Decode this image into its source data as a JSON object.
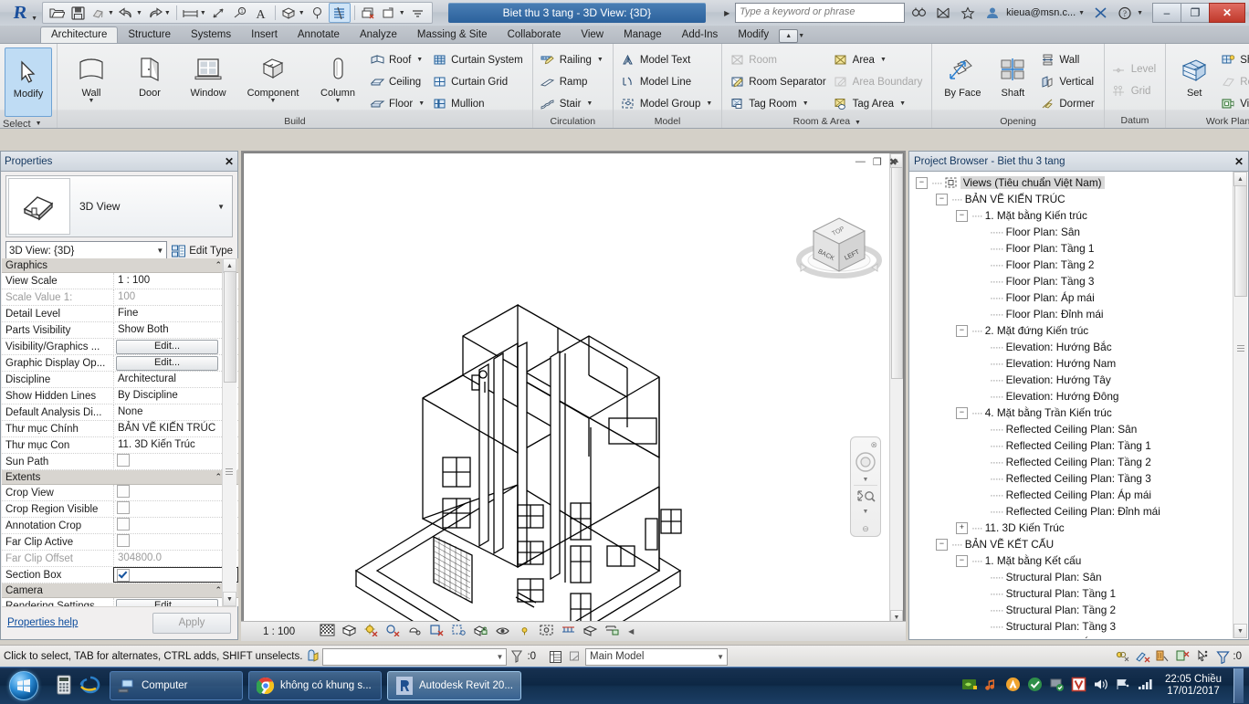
{
  "titlebar": {
    "app_title": "Biet thu 3 tang - 3D View: {3D}",
    "search_placeholder": "Type a keyword or phrase",
    "user": "kieua@msn.c...",
    "minimize": "–",
    "restore": "❐",
    "close": "✕"
  },
  "tabs": [
    {
      "label": "Architecture",
      "active": true
    },
    {
      "label": "Structure",
      "active": false
    },
    {
      "label": "Systems",
      "active": false
    },
    {
      "label": "Insert",
      "active": false
    },
    {
      "label": "Annotate",
      "active": false
    },
    {
      "label": "Analyze",
      "active": false
    },
    {
      "label": "Massing & Site",
      "active": false
    },
    {
      "label": "Collaborate",
      "active": false
    },
    {
      "label": "View",
      "active": false
    },
    {
      "label": "Manage",
      "active": false
    },
    {
      "label": "Add-Ins",
      "active": false
    },
    {
      "label": "Modify",
      "active": false
    }
  ],
  "ribbon": {
    "select_panel": {
      "button": "Modify",
      "caption": "Select"
    },
    "build": {
      "caption": "Build",
      "big": [
        {
          "label": "Wall",
          "dropdown": true
        },
        {
          "label": "Door",
          "dropdown": false
        },
        {
          "label": "Window",
          "dropdown": false
        },
        {
          "label": "Component",
          "dropdown": true
        },
        {
          "label": "Column",
          "dropdown": true
        }
      ],
      "col1": [
        {
          "label": "Roof",
          "dropdown": true
        },
        {
          "label": "Ceiling",
          "dropdown": false
        },
        {
          "label": "Floor",
          "dropdown": true
        }
      ],
      "col2": [
        {
          "label": "Curtain System",
          "dropdown": false
        },
        {
          "label": "Curtain Grid",
          "dropdown": false
        },
        {
          "label": "Mullion",
          "dropdown": false
        }
      ]
    },
    "circulation": {
      "caption": "Circulation",
      "items": [
        {
          "label": "Railing",
          "dropdown": true
        },
        {
          "label": "Ramp",
          "dropdown": false
        },
        {
          "label": "Stair",
          "dropdown": true
        }
      ]
    },
    "model": {
      "caption": "Model",
      "items": [
        {
          "label": "Model Text",
          "dropdown": false
        },
        {
          "label": "Model Line",
          "dropdown": false
        },
        {
          "label": "Model Group",
          "dropdown": true
        }
      ]
    },
    "room_area": {
      "caption": "Room & Area",
      "caption_dropdown": true,
      "col1": [
        {
          "label": "Room",
          "dropdown": false,
          "disabled": true
        },
        {
          "label": "Room Separator",
          "dropdown": false,
          "disabled": false
        },
        {
          "label": "Tag Room",
          "dropdown": true,
          "disabled": false
        }
      ],
      "col2": [
        {
          "label": "Area",
          "dropdown": true,
          "disabled": false
        },
        {
          "label": "Area Boundary",
          "dropdown": false,
          "disabled": true
        },
        {
          "label": "Tag Area",
          "dropdown": true,
          "disabled": false
        }
      ]
    },
    "opening": {
      "caption": "Opening",
      "big": [
        {
          "label": "By Face"
        },
        {
          "label": "Shaft"
        }
      ],
      "items": [
        {
          "label": "Wall",
          "disabled": false
        },
        {
          "label": "Vertical",
          "disabled": false
        },
        {
          "label": "Dormer",
          "disabled": false
        }
      ]
    },
    "datum": {
      "caption": "Datum",
      "items": [
        {
          "label": "Level",
          "disabled": true
        },
        {
          "label": "Grid",
          "disabled": true
        }
      ]
    },
    "workplane": {
      "caption": "Work Plane",
      "big": [
        {
          "label": "Set"
        }
      ],
      "items": [
        {
          "label": "Show",
          "disabled": false
        },
        {
          "label": "Ref Plane",
          "disabled": true
        },
        {
          "label": "Viewer",
          "disabled": false
        }
      ]
    }
  },
  "properties": {
    "title": "Properties",
    "close": "✕",
    "type_name": "3D View",
    "type_selector": "3D View: {3D}",
    "edit_type": "Edit Type",
    "help_link": "Properties help",
    "apply": "Apply",
    "groups": [
      {
        "name": "Graphics",
        "rows": [
          {
            "key": "View Scale",
            "value": "1 : 100",
            "kind": "text",
            "dim": false
          },
          {
            "key": "Scale Value    1:",
            "value": "100",
            "kind": "text",
            "dim": true
          },
          {
            "key": "Detail Level",
            "value": "Fine",
            "kind": "text",
            "dim": false
          },
          {
            "key": "Parts Visibility",
            "value": "Show Both",
            "kind": "text",
            "dim": false
          },
          {
            "key": "Visibility/Graphics ...",
            "value": "Edit...",
            "kind": "button",
            "dim": false
          },
          {
            "key": "Graphic Display Op...",
            "value": "Edit...",
            "kind": "button",
            "dim": false
          },
          {
            "key": "Discipline",
            "value": "Architectural",
            "kind": "text",
            "dim": false
          },
          {
            "key": "Show Hidden Lines",
            "value": "By Discipline",
            "kind": "text",
            "dim": false
          },
          {
            "key": "Default Analysis Di...",
            "value": "None",
            "kind": "text",
            "dim": false
          },
          {
            "key": "Thư mục Chính",
            "value": "BẢN VẼ KIẾN TRÚC",
            "kind": "text",
            "dim": false
          },
          {
            "key": "Thư mục Con",
            "value": "11. 3D Kiến Trúc",
            "kind": "text",
            "dim": false
          },
          {
            "key": "Sun Path",
            "value": "",
            "kind": "checkbox",
            "checked": false,
            "dim": false
          }
        ]
      },
      {
        "name": "Extents",
        "rows": [
          {
            "key": "Crop View",
            "value": "",
            "kind": "checkbox",
            "checked": false,
            "dim": false
          },
          {
            "key": "Crop Region Visible",
            "value": "",
            "kind": "checkbox",
            "checked": false,
            "dim": false
          },
          {
            "key": "Annotation Crop",
            "value": "",
            "kind": "checkbox",
            "checked": false,
            "dim": false
          },
          {
            "key": "Far Clip Active",
            "value": "",
            "kind": "checkbox",
            "checked": false,
            "dim": false
          },
          {
            "key": "Far Clip Offset",
            "value": "304800.0",
            "kind": "text",
            "dim": true
          },
          {
            "key": "Section Box",
            "value": "",
            "kind": "checkbox-active",
            "checked": true,
            "dim": false
          }
        ]
      },
      {
        "name": "Camera",
        "rows": [
          {
            "key": "Rendering Settings",
            "value": "Edit...",
            "kind": "button",
            "dim": false
          }
        ]
      }
    ]
  },
  "view": {
    "scale": "1 : 100",
    "viewcube_faces": {
      "top": "TOP",
      "front": "BACK",
      "right": "LEFT"
    },
    "win_minimize": "—",
    "win_restore": "❐",
    "win_close": "✖"
  },
  "browser": {
    "title": "Project Browser - Biet thu 3 tang",
    "close": "✕",
    "nodes": [
      {
        "label": "Views (Tiêu chuẩn Việt Nam)",
        "depth": 0,
        "exp": "minus",
        "selected": true,
        "icon": "views-icon"
      },
      {
        "label": "BẢN VẼ KIẾN TRÚC",
        "depth": 1,
        "exp": "minus",
        "selected": false
      },
      {
        "label": "1. Mặt bằng Kiến trúc",
        "depth": 2,
        "exp": "minus",
        "selected": false
      },
      {
        "label": "Floor Plan: Sân",
        "depth": 3,
        "exp": "leaf",
        "selected": false
      },
      {
        "label": "Floor Plan: Tầng 1",
        "depth": 3,
        "exp": "leaf",
        "selected": false
      },
      {
        "label": "Floor Plan: Tầng 2",
        "depth": 3,
        "exp": "leaf",
        "selected": false
      },
      {
        "label": "Floor Plan: Tầng 3",
        "depth": 3,
        "exp": "leaf",
        "selected": false
      },
      {
        "label": "Floor Plan: Áp mái",
        "depth": 3,
        "exp": "leaf",
        "selected": false
      },
      {
        "label": "Floor Plan: Đỉnh mái",
        "depth": 3,
        "exp": "leaf",
        "selected": false
      },
      {
        "label": "2. Mặt đứng Kiến trúc",
        "depth": 2,
        "exp": "minus",
        "selected": false
      },
      {
        "label": "Elevation: Hướng Bắc",
        "depth": 3,
        "exp": "leaf",
        "selected": false
      },
      {
        "label": "Elevation: Hướng Nam",
        "depth": 3,
        "exp": "leaf",
        "selected": false
      },
      {
        "label": "Elevation: Hướng Tây",
        "depth": 3,
        "exp": "leaf",
        "selected": false
      },
      {
        "label": "Elevation: Hướng Đông",
        "depth": 3,
        "exp": "leaf",
        "selected": false
      },
      {
        "label": "4. Mặt bằng Trần Kiến trúc",
        "depth": 2,
        "exp": "minus",
        "selected": false
      },
      {
        "label": "Reflected Ceiling Plan: Sân",
        "depth": 3,
        "exp": "leaf",
        "selected": false
      },
      {
        "label": "Reflected Ceiling Plan: Tầng 1",
        "depth": 3,
        "exp": "leaf",
        "selected": false
      },
      {
        "label": "Reflected Ceiling Plan: Tầng 2",
        "depth": 3,
        "exp": "leaf",
        "selected": false
      },
      {
        "label": "Reflected Ceiling Plan: Tầng 3",
        "depth": 3,
        "exp": "leaf",
        "selected": false
      },
      {
        "label": "Reflected Ceiling Plan: Áp mái",
        "depth": 3,
        "exp": "leaf",
        "selected": false
      },
      {
        "label": "Reflected Ceiling Plan: Đỉnh mái",
        "depth": 3,
        "exp": "leaf",
        "selected": false
      },
      {
        "label": "11. 3D Kiến Trúc",
        "depth": 2,
        "exp": "plus",
        "selected": false
      },
      {
        "label": "BẢN VẼ KẾT CẤU",
        "depth": 1,
        "exp": "minus",
        "selected": false
      },
      {
        "label": "1. Mặt bằng Kết cấu",
        "depth": 2,
        "exp": "minus",
        "selected": false
      },
      {
        "label": "Structural Plan: Sân",
        "depth": 3,
        "exp": "leaf",
        "selected": false
      },
      {
        "label": "Structural Plan: Tầng 1",
        "depth": 3,
        "exp": "leaf",
        "selected": false
      },
      {
        "label": "Structural Plan: Tầng 2",
        "depth": 3,
        "exp": "leaf",
        "selected": false
      },
      {
        "label": "Structural Plan: Tầng 3",
        "depth": 3,
        "exp": "leaf",
        "selected": false
      },
      {
        "label": "Structural Plan: Áp mái",
        "depth": 3,
        "exp": "leaf",
        "selected": false
      }
    ]
  },
  "statusbar": {
    "message": "Click to select, TAB for alternates, CTRL adds, SHIFT unselects.",
    "filter_value": "",
    "count": ":0",
    "worksets": "Main Model",
    "filter_count": ":0"
  },
  "taskbar": {
    "buttons": [
      {
        "label": "Computer",
        "icon": "computer-icon",
        "active": false
      },
      {
        "label": "không có khung s...",
        "icon": "chrome-icon",
        "active": false
      },
      {
        "label": "Autodesk Revit 20...",
        "icon": "revit-icon",
        "active": true
      }
    ],
    "clock_time": "22:05 Chiều",
    "clock_date": "17/01/2017"
  },
  "colors": {
    "accent": "#2b619c",
    "title_blue": "#4a7fb5",
    "ribbon_bg": "#e7e9ea",
    "taskbar": "#0d2744"
  }
}
